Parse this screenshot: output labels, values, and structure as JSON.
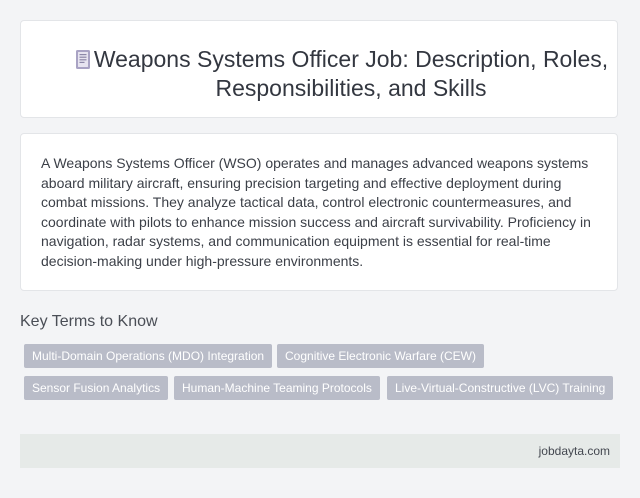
{
  "header": {
    "title": "Weapons Systems Officer Job: Description, Roles, Responsibilities, and Skills",
    "icon": "document-icon"
  },
  "main": {
    "description": "A Weapons Systems Officer (WSO) operates and manages advanced weapons systems aboard military aircraft, ensuring precision targeting and effective deployment during combat missions. They analyze tactical data, control electronic countermeasures, and coordinate with pilots to enhance mission success and aircraft survivability. Proficiency in navigation, radar systems, and communication equipment is essential for real-time decision-making under high-pressure environments."
  },
  "key_terms": {
    "heading": "Key Terms to Know",
    "tags": [
      "Multi-Domain Operations (MDO) Integration",
      "Cognitive Electronic Warfare (CEW)",
      "Sensor Fusion Analytics",
      "Human-Machine Teaming Protocols",
      "Live-Virtual-Constructive (LVC) Training"
    ]
  },
  "footer": {
    "source": "jobdayta.com"
  },
  "colors": {
    "background": "#f3f4f6",
    "card": "#ffffff",
    "tag": "#b9bcc8",
    "footer": "#e6eae8"
  }
}
